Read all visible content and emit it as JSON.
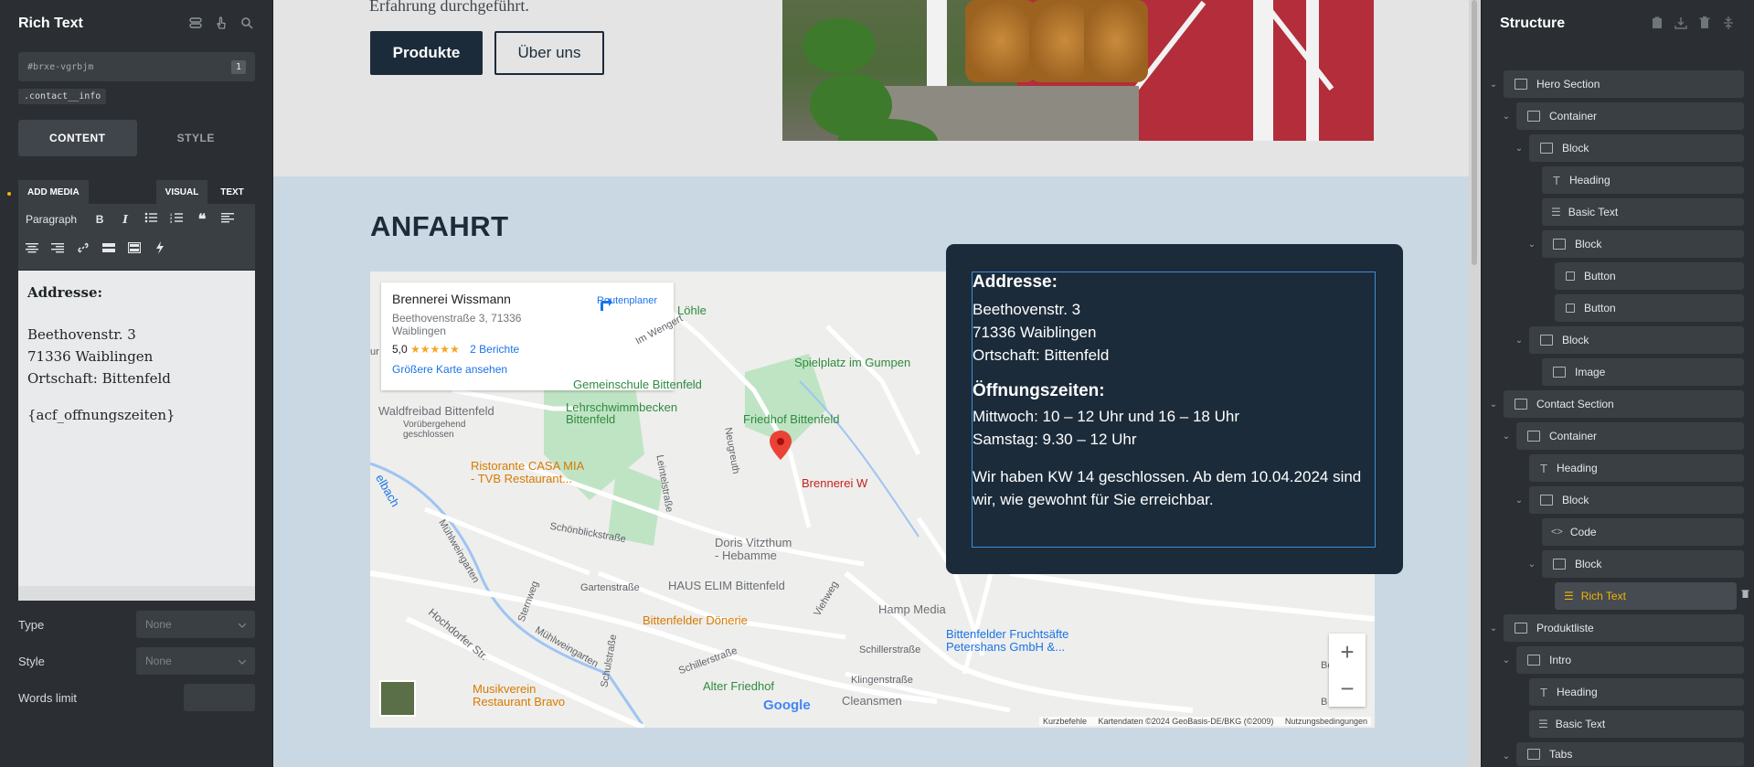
{
  "left_panel": {
    "title": "Rich Text",
    "element_id": "#brxe-vgrbjm",
    "id_count": "1",
    "css_class": ".contact__info",
    "tabs": {
      "content": "CONTENT",
      "style": "STYLE"
    },
    "editor_tabs": {
      "add_media": "ADD MEDIA",
      "visual": "VISUAL",
      "text": "TEXT"
    },
    "toolbar": {
      "format": "Paragraph"
    },
    "editor": {
      "heading": "Addresse:",
      "line1": "Beethovenstr. 3",
      "line2": "71336 Waiblingen",
      "line3": "Ortschaft: Bittenfeld",
      "placeholder_tag": "{acf_offnungszeiten}"
    },
    "fields": {
      "type_label": "Type",
      "type_value": "None",
      "style_label": "Style",
      "style_value": "None",
      "words_label": "Words limit"
    }
  },
  "canvas": {
    "hero": {
      "text": "Erfahrung durchgeführt.",
      "btn_primary": "Produkte",
      "btn_secondary": "Über uns"
    },
    "contact": {
      "title": "ANFAHRT",
      "map": {
        "place_name": "Brennerei Wissmann",
        "place_address": "Beethovenstraße 3, 71336 Waiblingen",
        "rating": "5,0",
        "stars": "★★★★★",
        "reviews": "2 Berichte",
        "larger_map": "Größere Karte ansehen",
        "route": "Routenplaner",
        "attribution_1": "Kurzbefehle",
        "attribution_2": "Kartendaten ©2024 GeoBasis-DE/BKG (©2009)",
        "attribution_3": "Nutzungsbedingungen",
        "labels": {
          "lohle": "Löhle",
          "im_wengert": "Im Wengert",
          "spielplatz": "Spielplatz im Gumpen",
          "schule": "Gemeinschule Bittenfeld",
          "lehrschwimm1": "Lehrschwimmbecken",
          "lehrschwimm2": "Bittenfeld",
          "waldfreibad": "Waldfreibad Bittenfeld",
          "voruber1": "Vorübergehend",
          "voruber2": "geschlossen",
          "friedhof": "Friedhof Bittenfeld",
          "casa1": "Ristorante CASA MIA",
          "casa2": "- TVB Restaurant...",
          "neugreuth": "Neugreuth",
          "leintelstr": "Leintelstraße",
          "brennerei_short": "Brennerei W",
          "bach": "elbach",
          "schonblick": "Schönblickstraße",
          "muhlweingarten": "Mühlweingarten",
          "doris1": "Doris Vitzthum",
          "doris2": "- Hebamme",
          "gartenstr": "Gartenstraße",
          "sternweg": "Sternweg",
          "haus_elim": "HAUS ELIM Bittenfeld",
          "hochdorfer": "Hochdorfer Str.",
          "muhlweingarten2": "Mühlweingarten",
          "schulstr": "Schulstraße",
          "donerie": "Bittenfelder Dönerie",
          "viehweg": "Viehweg",
          "hamp": "Hamp Media",
          "fruchtsafte1": "Bittenfelder Fruchtsäfte",
          "fruchtsafte2": "Petershans GmbH &...",
          "schillerstr": "Schillerstraße",
          "schillerstr2": "Schillerstraße",
          "klingenstr": "Klingenstraße",
          "musikverein1": "Musikverein",
          "musikverein2": "Restaurant Bravo",
          "alter_friedhof": "Alter Friedhof",
          "cleansmen": "Cleansmen",
          "google": "Google",
          "be": "Be",
          "bu": "B",
          "ur": "ur"
        }
      },
      "info": {
        "h1": "Addresse:",
        "l1": "Beethovenstr. 3",
        "l2": "71336 Waiblingen",
        "l3": "Ortschaft: Bittenfeld",
        "h2": "Öffnungszeiten:",
        "l4": "Mittwoch: 10 – 12 Uhr und  16 – 18 Uhr",
        "l5": "Samstag:  9.30 – 12 Uhr",
        "l6": "Wir haben KW 14 geschlossen. Ab dem 10.04.2024 sind wir, wie gewohnt für Sie erreichbar."
      }
    }
  },
  "right_panel": {
    "title": "Structure",
    "tree": [
      {
        "label": "Hero Section"
      },
      {
        "label": "Container"
      },
      {
        "label": "Block"
      },
      {
        "label": "Heading"
      },
      {
        "label": "Basic Text"
      },
      {
        "label": "Block"
      },
      {
        "label": "Button"
      },
      {
        "label": "Button"
      },
      {
        "label": "Block"
      },
      {
        "label": "Image"
      },
      {
        "label": "Contact Section"
      },
      {
        "label": "Container"
      },
      {
        "label": "Heading"
      },
      {
        "label": "Block"
      },
      {
        "label": "Code"
      },
      {
        "label": "Block"
      },
      {
        "label": "Rich Text"
      },
      {
        "label": "Produktliste"
      },
      {
        "label": "Intro"
      },
      {
        "label": "Heading"
      },
      {
        "label": "Basic Text"
      },
      {
        "label": "Tabs"
      }
    ]
  },
  "colors": {
    "panel_bg": "#2b2f33",
    "accent_yellow": "#f5b400",
    "navy": "#1b2b3a",
    "contact_bg": "#cad8e3",
    "selection_blue": "#3b8fdb"
  }
}
